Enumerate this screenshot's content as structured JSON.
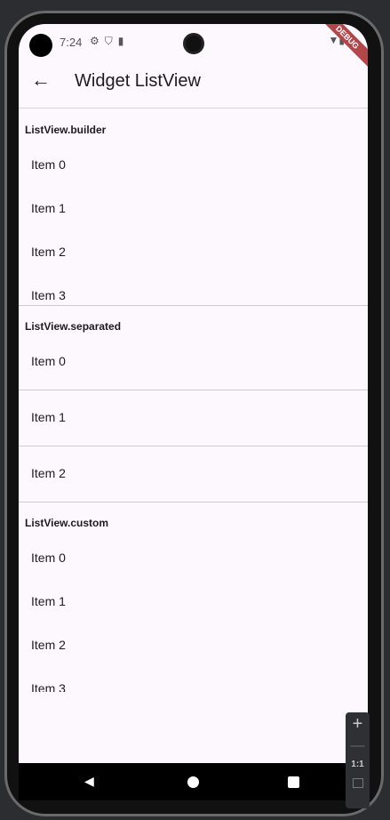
{
  "status": {
    "time": "7:24",
    "icons": [
      "settings-icon",
      "shield-icon",
      "sd-card-icon"
    ],
    "right_icons": [
      "wifi-icon",
      "battery-icon"
    ]
  },
  "debug_banner": "DEBUG",
  "appbar": {
    "title": "Widget ListView"
  },
  "sections": [
    {
      "title": "ListView.builder",
      "items": [
        "Item 0",
        "Item 1",
        "Item 2",
        "Item 3"
      ]
    },
    {
      "title": "ListView.separated",
      "items": [
        "Item 0",
        "Item 1",
        "Item 2"
      ]
    },
    {
      "title": "ListView.custom",
      "items": [
        "Item 0",
        "Item 1",
        "Item 2",
        "Item 3"
      ]
    }
  ],
  "zoom_controls": {
    "plus": "+",
    "minus": "—",
    "reset": "1:1"
  }
}
